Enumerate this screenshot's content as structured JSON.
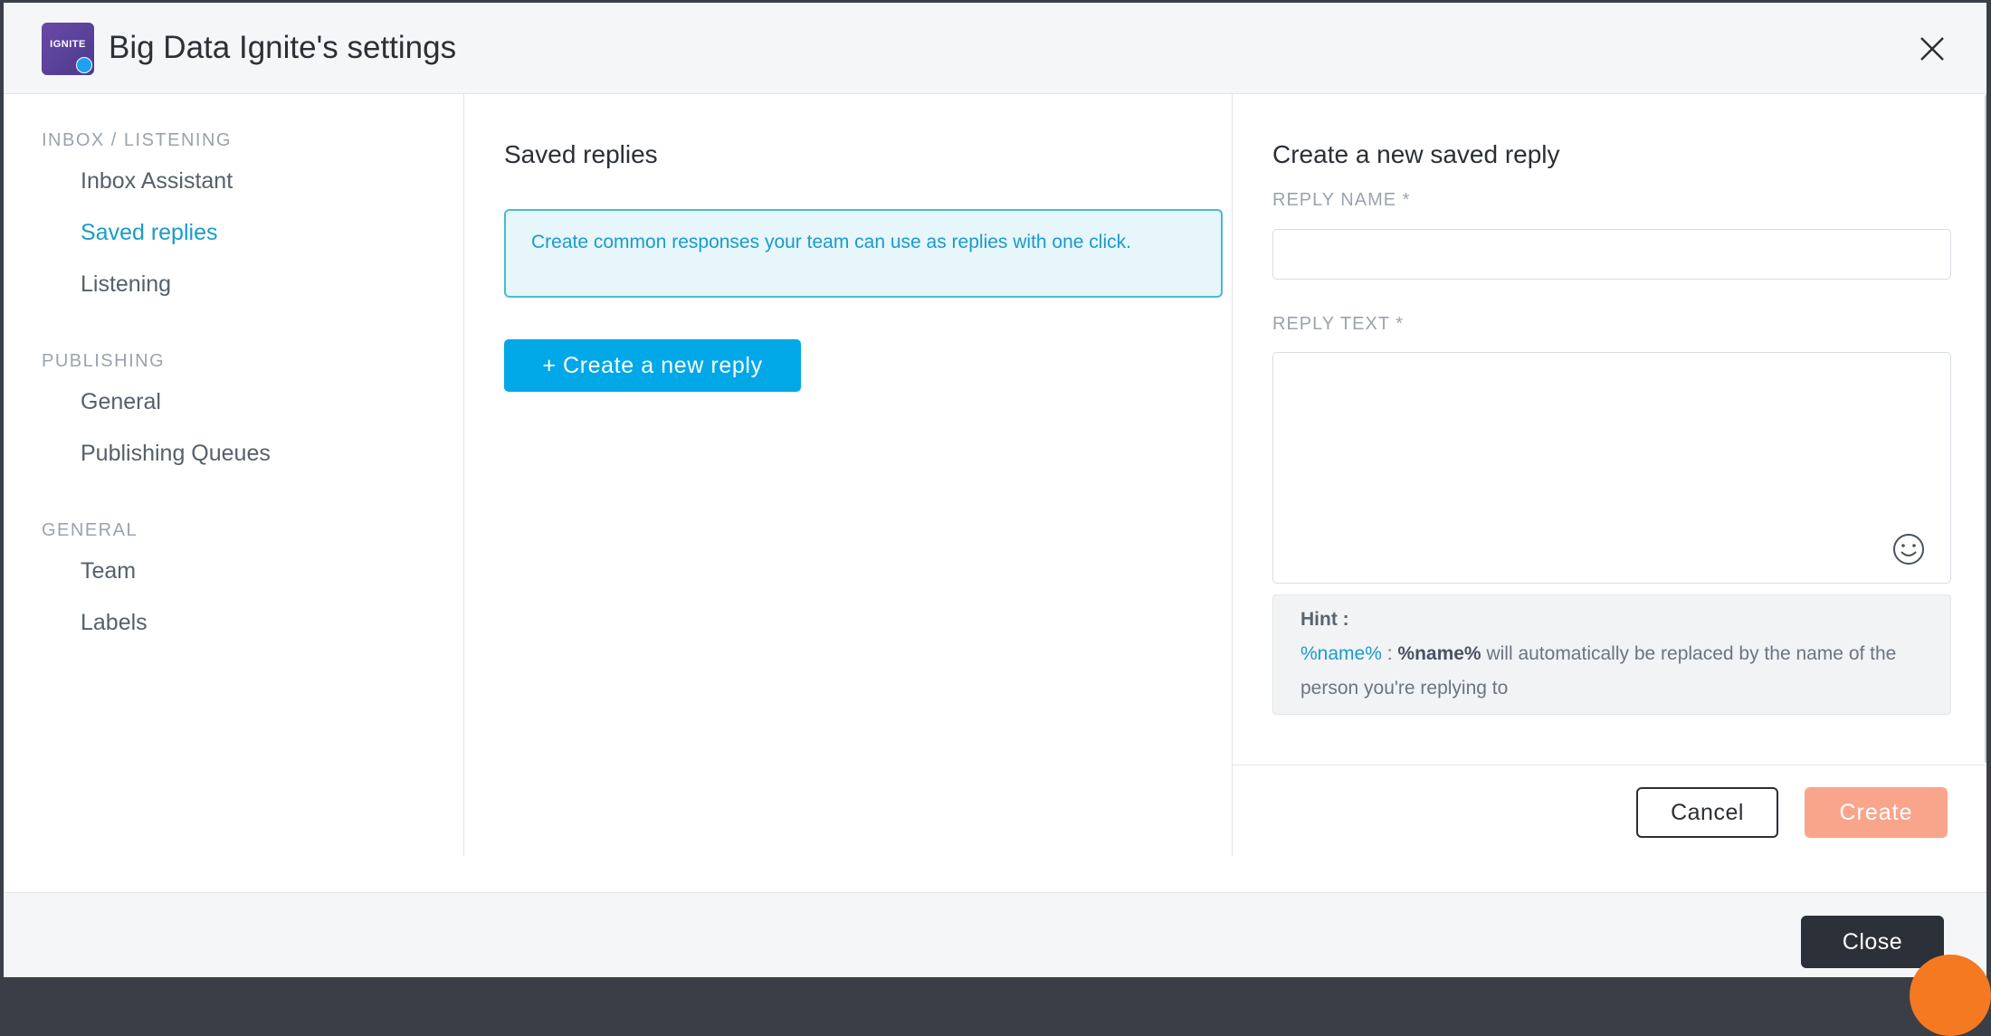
{
  "header": {
    "title": "Big Data Ignite's settings",
    "avatar_text": "IGNITE"
  },
  "sidebar": {
    "sections": [
      {
        "heading": "INBOX / LISTENING",
        "items": [
          "Inbox Assistant",
          "Saved replies",
          "Listening"
        ]
      },
      {
        "heading": "PUBLISHING",
        "items": [
          "General",
          "Publishing Queues"
        ]
      },
      {
        "heading": "GENERAL",
        "items": [
          "Team",
          "Labels"
        ]
      }
    ],
    "active_item": "Saved replies"
  },
  "middle": {
    "title": "Saved replies",
    "info": "Create common responses your team can use as replies with one click.",
    "create_button": "+ Create a new reply"
  },
  "form": {
    "title": "Create a new saved reply",
    "name_label": "REPLY NAME *",
    "name_value": "",
    "text_label": "REPLY TEXT *",
    "text_value": "",
    "hint": {
      "title": "Hint :",
      "variable": "%name%",
      "separator": " : ",
      "bold_var": "%name%",
      "description": " will automatically be replaced by the name of the person you're replying to"
    },
    "cancel_label": "Cancel",
    "create_label": "Create"
  },
  "footer": {
    "close_label": "Close"
  },
  "colors": {
    "accent": "#1a9bc9",
    "primary_button": "#00a8e8",
    "create_disabled": "#f8a58c",
    "dark_button": "#2c3038"
  }
}
